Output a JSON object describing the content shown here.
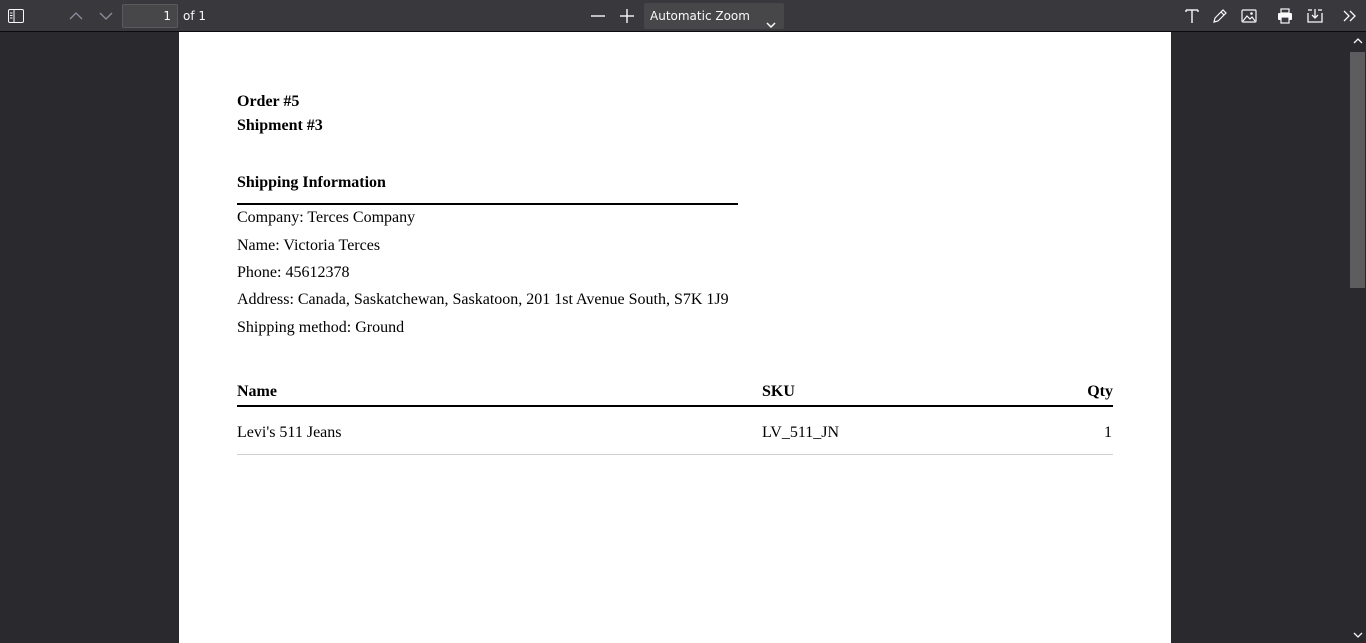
{
  "toolbar": {
    "page_number": "1",
    "page_count": "of 1",
    "zoom": "Automatic Zoom",
    "icons": [
      "sidebar-toggle-icon",
      "previous-page-icon",
      "next-page-icon",
      "zoom-out-icon",
      "zoom-in-icon",
      "chevron-down-icon",
      "text-tool-icon",
      "draw-tool-icon",
      "image-tool-icon",
      "print-icon",
      "download-icon",
      "more-tools-icon"
    ]
  },
  "document": {
    "order": "Order #5",
    "shipment": "Shipment #3",
    "section_title": "Shipping Information",
    "company": "Company: Terces Company",
    "name": "Name: Victoria Terces",
    "phone": "Phone: 45612378",
    "address": "Address: Canada, Saskatchewan, Saskatoon, 201 1st Avenue South, S7K 1J9",
    "shipping_method": "Shipping method: Ground",
    "table": {
      "headers": [
        "Name",
        "SKU",
        "Qty"
      ],
      "rows": [
        [
          "Levi's 511 Jeans",
          "LV_511_JN",
          "1"
        ]
      ]
    }
  }
}
